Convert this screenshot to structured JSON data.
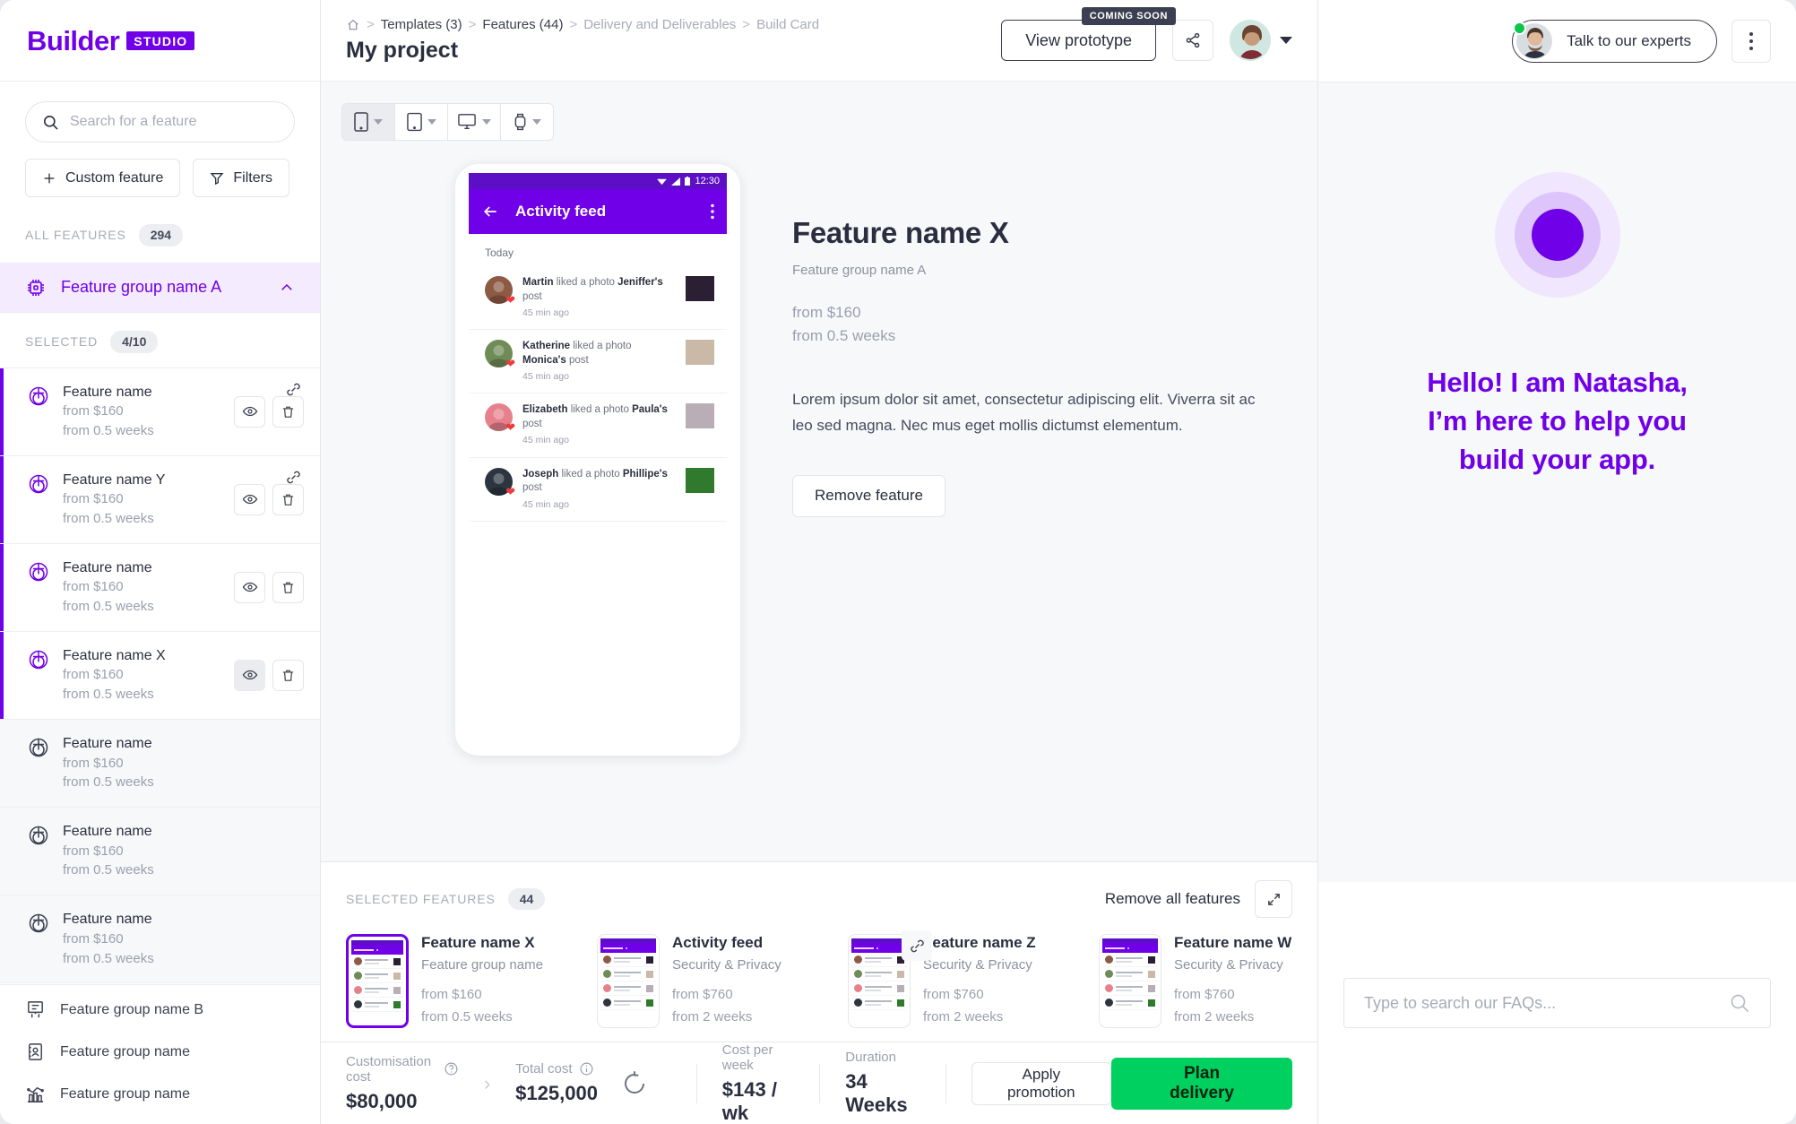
{
  "brand": {
    "word": "Builder",
    "tag": "STUDIO"
  },
  "sidebar": {
    "search": {
      "placeholder": "Search for a feature",
      "value": ""
    },
    "custom_feature_label": "Custom feature",
    "filters_label": "Filters",
    "all_features_label": "ALL FEATURES",
    "all_features_count": "294",
    "group": {
      "label": "Feature group name A",
      "expanded": true
    },
    "selected_label": "SELECTED",
    "selected_count": "4/10",
    "features": [
      {
        "name": "Feature name",
        "price": "from $160",
        "duration": "from 0.5 weeks",
        "selected": true,
        "linked": true,
        "eye_active": false
      },
      {
        "name": "Feature name Y",
        "price": "from $160",
        "duration": "from 0.5 weeks",
        "selected": true,
        "linked": true,
        "eye_active": false
      },
      {
        "name": "Feature name",
        "price": "from $160",
        "duration": "from 0.5 weeks",
        "selected": true,
        "linked": false,
        "eye_active": false
      },
      {
        "name": "Feature name X",
        "price": "from $160",
        "duration": "from 0.5 weeks",
        "selected": true,
        "linked": false,
        "eye_active": true
      },
      {
        "name": "Feature name",
        "price": "from $160",
        "duration": "from 0.5 weeks",
        "selected": false,
        "linked": false,
        "eye_active": false
      },
      {
        "name": "Feature name",
        "price": "from $160",
        "duration": "from 0.5 weeks",
        "selected": false,
        "linked": false,
        "eye_active": false
      },
      {
        "name": "Feature name",
        "price": "from $160",
        "duration": "from 0.5 weeks",
        "selected": false,
        "linked": false,
        "eye_active": false
      }
    ],
    "groups": [
      {
        "label": "Feature group name B",
        "icon": "presentation-board-icon"
      },
      {
        "label": "Feature group name",
        "icon": "address-book-icon"
      },
      {
        "label": "Feature group name",
        "icon": "bar-chart-icon"
      }
    ]
  },
  "header": {
    "breadcrumb": [
      {
        "label": "home-icon",
        "type": "icon"
      },
      {
        "label": "Templates (3)",
        "type": "dark"
      },
      {
        "label": "Features (44)",
        "type": "dark"
      },
      {
        "label": "Delivery and Deliverables",
        "type": "light"
      },
      {
        "label": "Build Card",
        "type": "light"
      }
    ],
    "title": "My project",
    "view_prototype_label": "View prototype",
    "coming_soon_badge": "COMING SOON",
    "share_icon": "share-icon"
  },
  "device_bar": [
    {
      "icon": "phone-icon",
      "active": true
    },
    {
      "icon": "tablet-icon",
      "active": false
    },
    {
      "icon": "desktop-icon",
      "active": false
    },
    {
      "icon": "watch-icon",
      "active": false
    }
  ],
  "preview": {
    "status_time": "12:30",
    "appbar_title": "Activity feed",
    "section_label": "Today",
    "feed": [
      {
        "actor": "Martin",
        "action": "liked a photo",
        "owner": "Jeniffer's",
        "suffix": "post",
        "time": "45 min ago",
        "avatar_color": "#8d5a44",
        "thumb_color": "#2b2033"
      },
      {
        "actor": "Katherine",
        "action": "liked a photo",
        "owner": "Monica's",
        "suffix": "post",
        "time": "45 min ago",
        "avatar_color": "#6f8b56",
        "thumb_color": "#c9b9a6"
      },
      {
        "actor": "Elizabeth",
        "action": "liked a photo",
        "owner": "Paula's",
        "suffix": "post",
        "time": "45 min ago",
        "avatar_color": "#e6818c",
        "thumb_color": "#b9aeb6"
      },
      {
        "actor": "Joseph",
        "action": "liked a photo",
        "owner": "Phillipe's",
        "suffix": "post",
        "time": "45 min ago",
        "avatar_color": "#2d3540",
        "thumb_color": "#2f7a2c"
      }
    ]
  },
  "detail": {
    "title": "Feature name X",
    "group": "Feature group name A",
    "price": "from $160",
    "duration": "from 0.5 weeks",
    "description": "Lorem ipsum dolor sit amet, consectetur adipiscing elit. Viverra sit ac leo sed magna. Nec mus eget mollis dictumst elementum.",
    "remove_label": "Remove feature"
  },
  "strip": {
    "label": "SELECTED FEATURES",
    "count": "44",
    "remove_all_label": "Remove all features",
    "expand_icon": "expand-icon",
    "cards": [
      {
        "name": "Feature name X",
        "group": "Feature group name",
        "price": "from $160",
        "duration": "from 0.5 weeks",
        "selected": true,
        "linked": false
      },
      {
        "name": "Activity feed",
        "group": "Security & Privacy",
        "price": "from $760",
        "duration": "from 2 weeks",
        "selected": false,
        "linked": false
      },
      {
        "name": "Feature name Z",
        "group": "Security & Privacy",
        "price": "from $760",
        "duration": "from 2 weeks",
        "selected": false,
        "linked": true
      },
      {
        "name": "Feature name W",
        "group": "Security & Privacy",
        "price": "from $760",
        "duration": "from 2 weeks",
        "selected": false,
        "linked": false
      }
    ]
  },
  "bottom_bar": {
    "customisation_label": "Customisation cost",
    "customisation_value": "$80,000",
    "total_label": "Total cost",
    "total_value": "$125,000",
    "cost_week_label": "Cost per week",
    "cost_week_value": "$143 / wk",
    "duration_label": "Duration",
    "duration_value": "34 Weeks",
    "apply_promotion_label": "Apply promotion",
    "plan_delivery_label": "Plan delivery"
  },
  "right_panel": {
    "experts_label": "Talk to our experts",
    "hero_line1": "Hello! I am Natasha,",
    "hero_line2": "I’m here to help you",
    "hero_line3": "build your app.",
    "faq_placeholder": "Type to search our FAQs...",
    "faq_value": "",
    "search_icon": "search-icon"
  },
  "colors": {
    "brand_purple": "#7000e8",
    "core_purple": "#6f00e8",
    "accent_green": "#00d05f"
  }
}
